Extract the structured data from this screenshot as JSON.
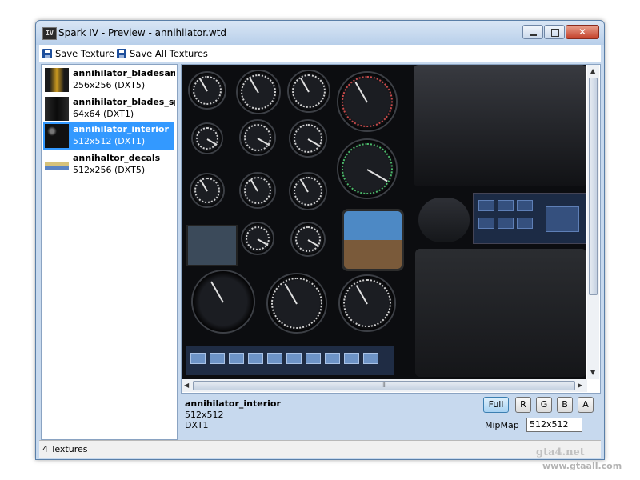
{
  "window": {
    "title": "Spark IV - Preview - annihilator.wtd",
    "app_icon": "IV"
  },
  "toolbar": {
    "save_texture": "Save Texture",
    "save_all_textures": "Save All Textures"
  },
  "textures": [
    {
      "name": "annihilator_bladesannihi",
      "info": "256x256 (DXT5)",
      "selected": false
    },
    {
      "name": "annihilator_blades_spec",
      "info": "64x64 (DXT1)",
      "selected": false
    },
    {
      "name": "annihilator_interior",
      "info": "512x512 (DXT1)",
      "selected": true
    },
    {
      "name": "annihaltor_decals",
      "info": "512x256 (DXT5)",
      "selected": false
    }
  ],
  "preview": {
    "name": "annihilator_interior",
    "size": "512x512",
    "format": "DXT1",
    "scrollbar_grip": "III"
  },
  "channels": {
    "full": "Full",
    "r": "R",
    "g": "G",
    "b": "B",
    "a": "A"
  },
  "mipmap": {
    "label": "MipMap",
    "value": "512x512"
  },
  "status": {
    "count": "4 Textures"
  },
  "watermark": {
    "text": "gta4.net",
    "site": "www.gtaall.com"
  },
  "icons": {
    "app": "spark-iv-icon",
    "minimize": "minimize-icon",
    "maximize": "maximize-icon",
    "close": "close-icon",
    "save": "floppy-disk-icon",
    "save_all": "floppy-disk-icon"
  }
}
